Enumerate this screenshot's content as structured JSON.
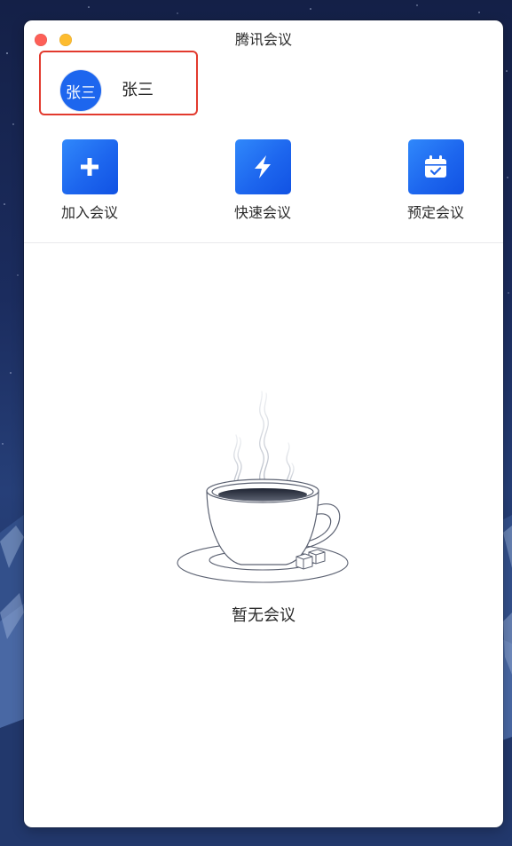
{
  "window": {
    "title": "腾讯会议"
  },
  "user": {
    "avatar_text": "张三",
    "name": "张三"
  },
  "actions": [
    {
      "label": "加入会议",
      "icon": "plus-icon"
    },
    {
      "label": "快速会议",
      "icon": "lightning-icon"
    },
    {
      "label": "预定会议",
      "icon": "calendar-icon"
    }
  ],
  "empty_state": {
    "text": "暂无会议",
    "illustration": "coffee-cup-icon"
  },
  "colors": {
    "accent": "#1d66ee",
    "accent_dark": "#1152e3",
    "highlight": "#e23a2e",
    "close": "#fd5f57",
    "minimize": "#fdbc2f"
  }
}
